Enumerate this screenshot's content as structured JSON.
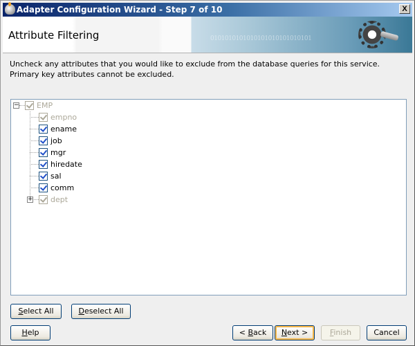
{
  "window": {
    "title": "Adapter Configuration Wizard - Step 7 of 10",
    "close_label": "X"
  },
  "header": {
    "title": "Attribute Filtering",
    "banner_bits": "0101010101010101010101010101"
  },
  "description": "Uncheck any attributes that you would like to exclude from the database queries for this service.  Primary key attributes cannot be excluded.",
  "tree": {
    "root": {
      "label": "EMP",
      "checked": true,
      "disabled": true,
      "expanded": true
    },
    "children": [
      {
        "label": "empno",
        "checked": true,
        "disabled": true
      },
      {
        "label": "ename",
        "checked": true,
        "disabled": false
      },
      {
        "label": "job",
        "checked": true,
        "disabled": false
      },
      {
        "label": "mgr",
        "checked": true,
        "disabled": false
      },
      {
        "label": "hiredate",
        "checked": true,
        "disabled": false
      },
      {
        "label": "sal",
        "checked": true,
        "disabled": false
      },
      {
        "label": "comm",
        "checked": true,
        "disabled": false
      },
      {
        "label": "dept",
        "checked": true,
        "disabled": true,
        "expandable": true
      }
    ]
  },
  "buttons": {
    "select_all": {
      "pre": "",
      "mn": "S",
      "rest": "elect All"
    },
    "deselect_all": {
      "pre": "",
      "mn": "D",
      "rest": "eselect All"
    },
    "help": {
      "pre": "",
      "mn": "H",
      "rest": "elp"
    },
    "back": {
      "pre": "< ",
      "mn": "B",
      "rest": "ack"
    },
    "next": {
      "pre": "",
      "mn": "N",
      "rest": "ext >"
    },
    "finish": {
      "pre": "",
      "mn": "F",
      "rest": "inish",
      "disabled": true
    },
    "cancel": {
      "pre": "",
      "mn": "",
      "rest": "Cancel"
    }
  }
}
